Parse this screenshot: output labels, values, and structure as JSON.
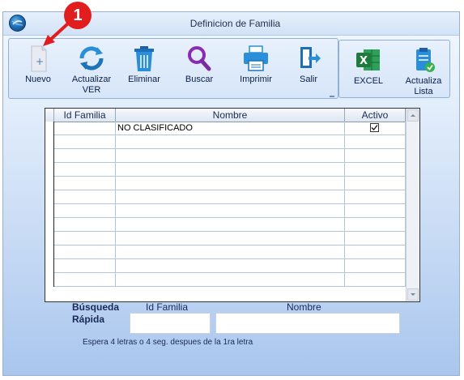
{
  "window": {
    "title": "Definicion de Familia"
  },
  "annotation": {
    "badge_number": "1"
  },
  "toolbar": {
    "items": [
      {
        "label": "Nuevo",
        "icon": "new-document-icon"
      },
      {
        "label": "Actualizar\nVER",
        "icon": "refresh-icon"
      },
      {
        "label": "Eliminar",
        "icon": "trash-icon"
      },
      {
        "label": "Buscar",
        "icon": "magnifier-icon"
      },
      {
        "label": "Imprimir",
        "icon": "printer-icon"
      },
      {
        "label": "Salir",
        "icon": "exit-door-icon"
      }
    ],
    "extra": [
      {
        "label": "EXCEL",
        "icon": "excel-icon"
      },
      {
        "label": "Actualiza\nLista",
        "icon": "clipboard-check-icon"
      }
    ]
  },
  "grid": {
    "columns": [
      "Id Familia",
      "Nombre",
      "Activo"
    ],
    "rows": [
      {
        "id": "",
        "nombre": "NO CLASIFICADO",
        "activo": true
      }
    ],
    "empty_rows": 11
  },
  "quick_search": {
    "label_line1": "Búsqueda",
    "label_line2": "Rápida",
    "id_label": "Id Familia",
    "name_label": "Nombre",
    "id_value": "",
    "name_value": "",
    "hint": "Espera 4 letras o 4 seg. despues de la 1ra letra"
  },
  "colors": {
    "accent": "#1f6fb8",
    "badge": "#e21d1d",
    "excel_green": "#1e7b3c"
  }
}
